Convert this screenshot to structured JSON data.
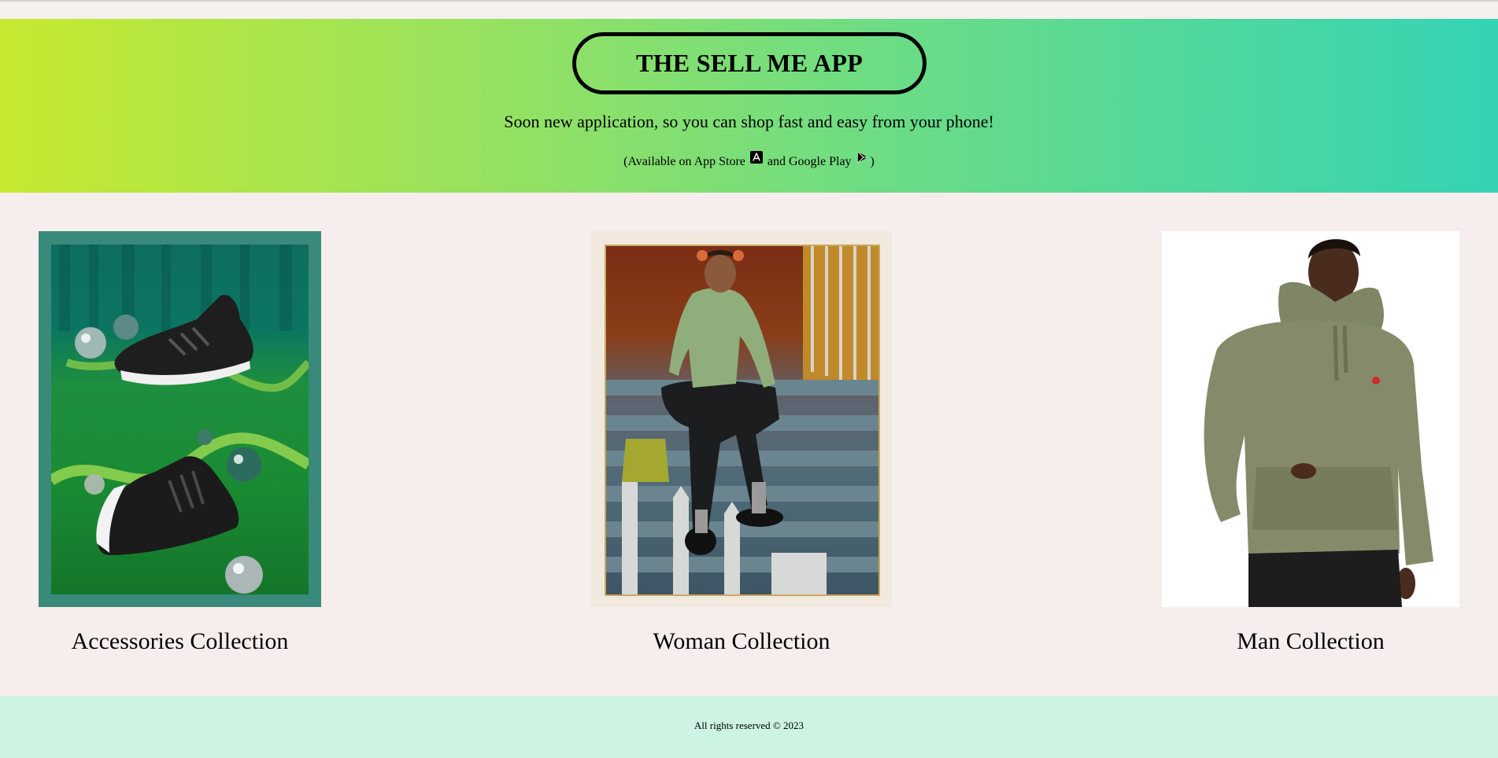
{
  "hero": {
    "app_title": "THE SELL ME APP",
    "tagline": "Soon new application, so you can shop fast and easy from your phone!",
    "availability_prefix": "(Available on App Store",
    "availability_middle": "and Google Play",
    "availability_suffix": ")",
    "app_store_icon": "app-store-icon",
    "google_play_icon": "google-play-icon",
    "gradient_colors": [
      "#c6e930",
      "#34d3b4"
    ]
  },
  "collections": [
    {
      "label": "Accessories Collection",
      "image": "sneakers-photo"
    },
    {
      "label": "Woman Collection",
      "image": "woman-on-stairs-photo"
    },
    {
      "label": "Man Collection",
      "image": "man-in-hoodie-photo"
    }
  ],
  "footer": {
    "text": "All rights reserved © 2023",
    "background": "#cdf3e2"
  }
}
